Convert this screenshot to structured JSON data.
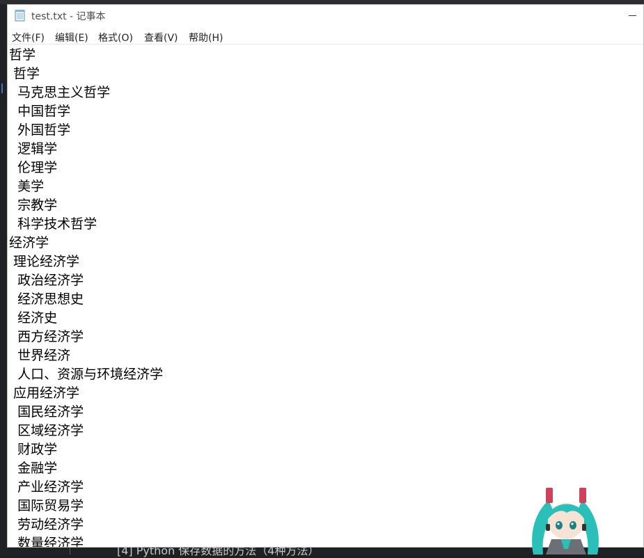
{
  "window": {
    "title": "test.txt - 记事本",
    "menu": [
      {
        "label": "文件(F)"
      },
      {
        "label": "编辑(E)"
      },
      {
        "label": "格式(O)"
      },
      {
        "label": "查看(V)"
      },
      {
        "label": "帮助(H)"
      }
    ]
  },
  "editor": {
    "lines": [
      "哲学",
      " 哲学",
      "  马克思主义哲学",
      "  中国哲学",
      "  外国哲学",
      "  逻辑学",
      "  伦理学",
      "  美学",
      "  宗教学",
      "  科学技术哲学",
      "经济学",
      " 理论经济学",
      "  政治经济学",
      "  经济思想史",
      "  经济史",
      "  西方经济学",
      "  世界经济",
      "  人口、资源与环境经济学",
      " 应用经济学",
      "  国民经济学",
      "  区域经济学",
      "  财政学",
      "  金融学",
      "  产业经济学",
      "  国际贸易学",
      "  劳动经济学",
      "  数量经济学"
    ]
  },
  "background": {
    "bottom_text": "[4] Python 保存数据的方法（4种方法）"
  },
  "icons": {
    "app": "notepad-icon",
    "mascot": "anime-mascot-icon"
  },
  "colors": {
    "mascot_hair": "#2bbfb9",
    "mascot_accent": "#d1415b"
  }
}
